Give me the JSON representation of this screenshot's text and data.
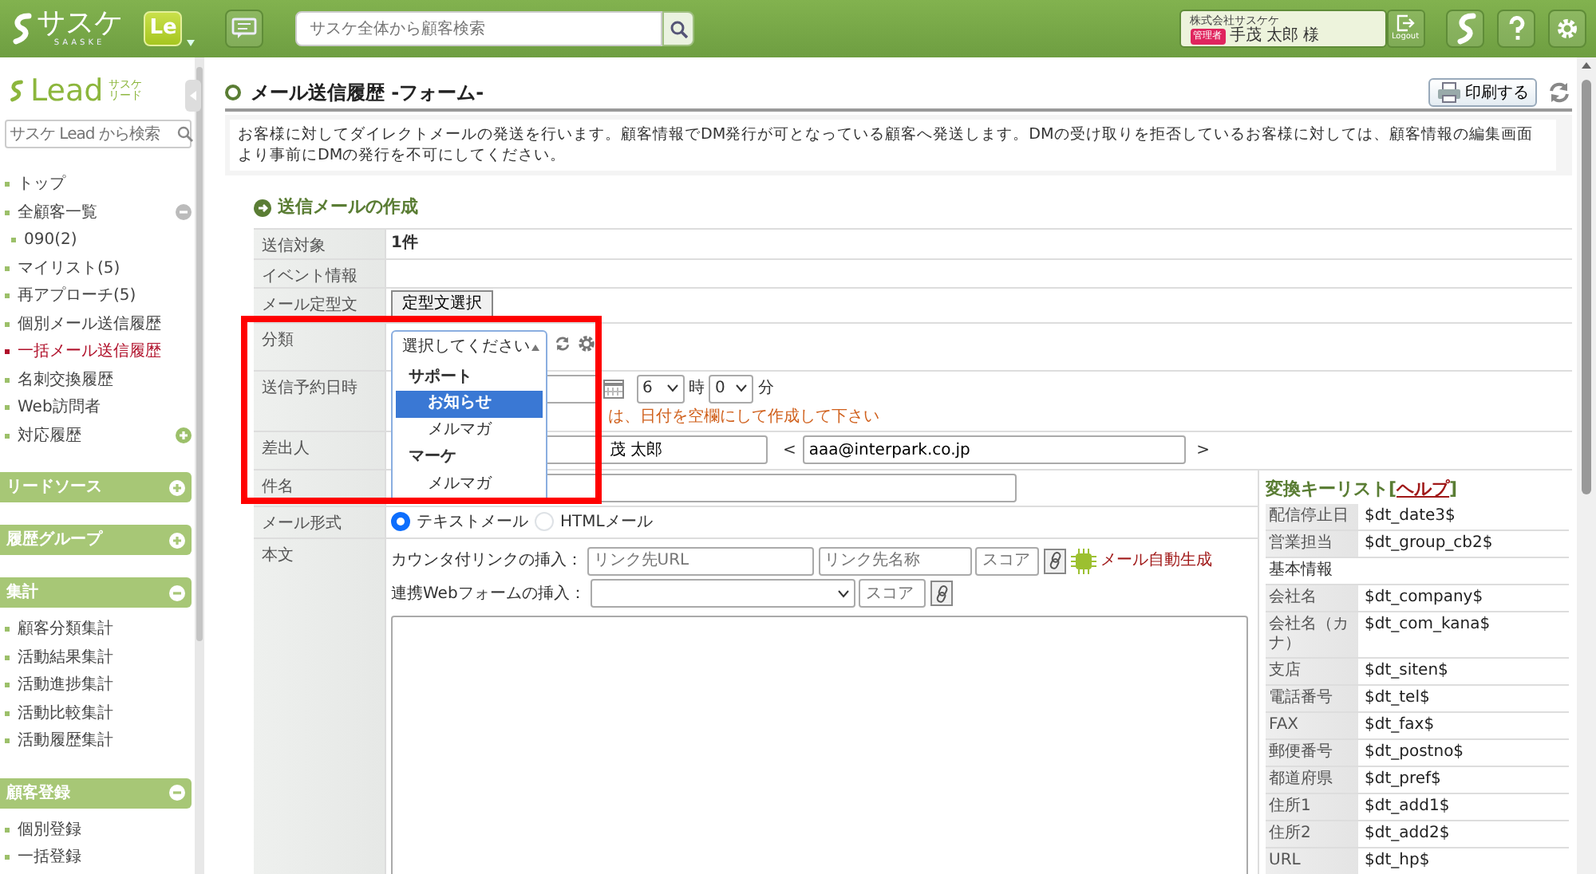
{
  "header": {
    "logo": "サスケ",
    "logo_caption": "SAASKE",
    "app_badge": "Le",
    "search": {
      "placeholder": "サスケ全体から顧客検索"
    },
    "user": {
      "company": "株式会社サスケケ",
      "role": "管理者",
      "name": "手茂 太郎 様"
    },
    "logout": "Logout"
  },
  "sidebar": {
    "brand": "Lead",
    "brand_caption": [
      "サスケ",
      "リード"
    ],
    "search": {
      "placeholder": "サスケ Lead から検索"
    },
    "nav": [
      {
        "label": "トップ",
        "kind": "link",
        "selected": false
      },
      {
        "label": "全顧客一覧",
        "kind": "folder",
        "selected": false,
        "expanded": true,
        "children": [
          {
            "label": "090(2)",
            "selected": false
          }
        ]
      },
      {
        "label": "マイリスト(5)",
        "kind": "link",
        "selected": false
      },
      {
        "label": "再アプローチ(5)",
        "kind": "link",
        "selected": false
      },
      {
        "label": "個別メール送信履歴",
        "kind": "link",
        "selected": false
      },
      {
        "label": "一括メール送信履歴",
        "kind": "link",
        "selected": true
      },
      {
        "label": "名刺交換履歴",
        "kind": "link",
        "selected": false
      },
      {
        "label": "Web訪問者",
        "kind": "link",
        "selected": false
      },
      {
        "label": "対応履歴",
        "kind": "folder",
        "selected": false,
        "expanded": false
      }
    ],
    "groups": [
      {
        "title": "リードソース",
        "expanded": false
      },
      {
        "title": "履歴グループ",
        "expanded": false
      },
      {
        "title": "集計",
        "expanded": true,
        "items": [
          "顧客分類集計",
          "活動結果集計",
          "活動進捗集計",
          "活動比較集計",
          "活動履歴集計"
        ]
      },
      {
        "title": "顧客登録",
        "expanded": true,
        "items": [
          "個別登録",
          "一括登録"
        ]
      }
    ]
  },
  "page": {
    "title": "メール送信履歴 -フォーム-",
    "print_button": "印刷する",
    "description": "お客様に対してダイレクトメールの発送を行います。顧客情報でDM発行が可となっている顧客へ発送します。DMの受け取りを拒否しているお客様に対しては、顧客情報の編集画面より事前にDMの発行を不可にしてください。"
  },
  "form": {
    "section_title": "送信メールの作成",
    "rows": [
      {
        "label": "送信対象",
        "kind": "text",
        "value": "1件"
      },
      {
        "label": "イベント情報",
        "kind": "empty"
      },
      {
        "label": "メール定型文",
        "kind": "button",
        "button": "定型文選択"
      },
      {
        "label": "分類",
        "kind": "category",
        "select": {
          "value": "選択してください",
          "expanded": true,
          "options": [
            {
              "label": "サポート",
              "kind": "group",
              "selected": false
            },
            {
              "label": "お知らせ",
              "kind": "option",
              "selected": true
            },
            {
              "label": "メルマガ",
              "kind": "option",
              "selected": false
            },
            {
              "label": "マーケ",
              "kind": "group",
              "selected": false
            },
            {
              "label": "メルマガ",
              "kind": "option",
              "selected": false
            }
          ]
        }
      },
      {
        "label": "送信予約日時",
        "kind": "schedule",
        "hour": "6",
        "hour_unit": "時",
        "minute": "0",
        "minute_unit": "分",
        "note": "は、日付を空欄にして作成して下さい"
      },
      {
        "label": "差出人",
        "kind": "sender",
        "name": "茂 太郎",
        "open": "<",
        "email": "aaa@interpark.co.jp",
        "close": ">"
      },
      {
        "label": "件名",
        "kind": "input"
      },
      {
        "label": "メール形式",
        "kind": "format",
        "options": [
          {
            "label": "テキストメール",
            "selected": true
          },
          {
            "label": "HTMLメール",
            "selected": false
          }
        ]
      },
      {
        "label": "本文",
        "kind": "body",
        "link_label": "カウンタ付リンクの挿入：",
        "url_placeholder": "リンク先URL",
        "name_placeholder": "リンク先名称",
        "score_placeholder": "スコア",
        "ai_button": "メール自動生成",
        "form_label": "連携Webフォームの挿入：",
        "form_score_placeholder": "スコア",
        "key_list": {
          "title_before": "変換キーリスト[",
          "help_link": "ヘルプ",
          "title_after": "]",
          "rows": [
            {
              "kind": "key",
              "label": "配信停止日",
              "key": "$dt_date3$"
            },
            {
              "kind": "key",
              "label": "営業担当",
              "key": "$dt_group_cb2$"
            },
            {
              "kind": "heading",
              "label": "基本情報"
            },
            {
              "kind": "key",
              "label": "会社名",
              "key": "$dt_company$"
            },
            {
              "kind": "key",
              "label": "会社名（カナ）",
              "key": "$dt_com_kana$"
            },
            {
              "kind": "key",
              "label": "支店",
              "key": "$dt_siten$"
            },
            {
              "kind": "key",
              "label": "電話番号",
              "key": "$dt_tel$"
            },
            {
              "kind": "key",
              "label": "FAX",
              "key": "$dt_fax$"
            },
            {
              "kind": "key",
              "label": "郵便番号",
              "key": "$dt_postno$"
            },
            {
              "kind": "key",
              "label": "都道府県",
              "key": "$dt_pref$"
            },
            {
              "kind": "key",
              "label": "住所1",
              "key": "$dt_add1$"
            },
            {
              "kind": "key",
              "label": "住所2",
              "key": "$dt_add2$"
            },
            {
              "kind": "key",
              "label": "URL",
              "key": "$dt_hp$"
            }
          ]
        }
      }
    ]
  }
}
